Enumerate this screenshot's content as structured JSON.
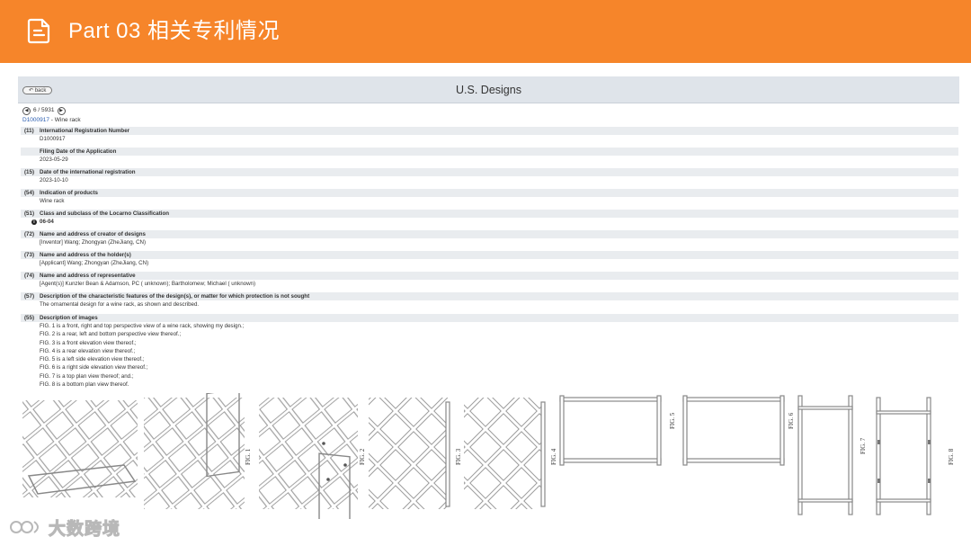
{
  "header": {
    "title": "Part 03  相关专利情况",
    "icon": "document-icon",
    "bg_color": "#f6852a"
  },
  "page": {
    "back_label": "back",
    "heading": "U.S. Designs",
    "pager_text": "6 / 5931",
    "record_id": "D1000917",
    "record_sep": " - ",
    "record_title": "Wine rack"
  },
  "sections": [
    {
      "num": "(11)",
      "label": "International Registration Number",
      "values": [
        "D1000917"
      ]
    },
    {
      "num": "",
      "label": "Filing Date of the Application",
      "values": [
        "2023-05-29"
      ]
    },
    {
      "num": "(15)",
      "label": "Date of the international registration",
      "values": [
        "2023-10-10"
      ]
    },
    {
      "num": "(54)",
      "label": "Indication of products",
      "values": [
        "Wine rack"
      ]
    },
    {
      "num": "(51)",
      "label": "Class and subclass of the Locarno Classification",
      "values": [
        "06-04"
      ]
    },
    {
      "num": "(72)",
      "label": "Name and address of creator of designs",
      "values": [
        "[Inventor] Wang; Zhongyan (ZheJiang, CN)"
      ]
    },
    {
      "num": "(73)",
      "label": "Name and address of the holder(s)",
      "values": [
        "[Applicant]  Wang; Zhongyan (ZheJiang, CN)"
      ]
    },
    {
      "num": "(74)",
      "label": "Name and address of representative",
      "values": [
        "[Agent(s)] Kunzler Bean & Adamson, PC ( unknown); Bartholomew; Michael ( unknown)"
      ]
    },
    {
      "num": "(57)",
      "label": "Description of the characteristic features of the design(s), or matter for which protection is not sought",
      "values": [
        "The ornamental design for a wine rack, as shown and described."
      ]
    },
    {
      "num": "(55)",
      "label": "Description of images",
      "values": [
        "FIG. 1 is a front, right and top perspective view of a wine rack, showing my design.;",
        "FIG. 2 is a rear, left and bottom perspective view thereof.;",
        "FIG. 3 is a front elevation view thereof.;",
        "FIG. 4 is a rear elevation view thereof.;",
        "FIG. 5 is a left side elevation view thereof.;",
        "FIG. 6 is a right side elevation view thereof.;",
        "FIG. 7 is a top plan view thereof; and.;",
        "FIG. 8 is a bottom plan view thereof."
      ]
    }
  ],
  "figures": {
    "labels": [
      "FIG. 1",
      "FIG. 2",
      "FIG. 3",
      "FIG. 4",
      "FIG. 5",
      "FIG. 6",
      "FIG. 7",
      "FIG. 8"
    ]
  },
  "footer": {
    "brand": "大数跨境",
    "logo_icon": "brand-logo-icon"
  }
}
